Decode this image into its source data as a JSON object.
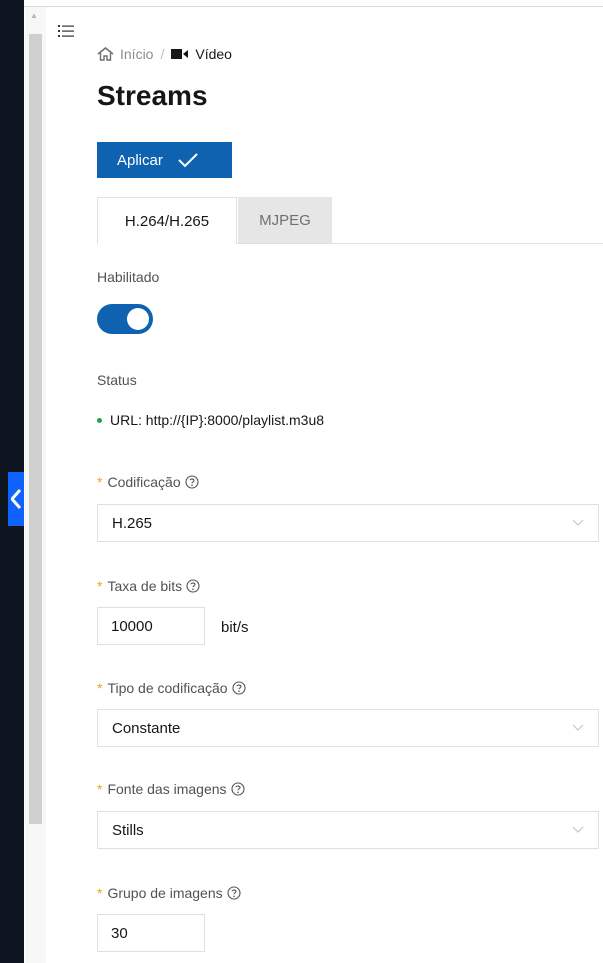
{
  "breadcrumb": {
    "home": "Início",
    "separator": "/",
    "current": "Vídeo"
  },
  "page": {
    "title": "Streams"
  },
  "toolbar": {
    "apply_label": "Aplicar"
  },
  "tabs": [
    {
      "label": "H.264/H.265",
      "active": true
    },
    {
      "label": "MJPEG",
      "active": false
    }
  ],
  "enabled": {
    "label": "Habilitado",
    "value": true
  },
  "status": {
    "label": "Status",
    "url": "URL: http://{IP}:8000/playlist.m3u8"
  },
  "fields": {
    "encoding": {
      "label": "Codificação",
      "value": "H.265"
    },
    "bitrate": {
      "label": "Taxa de bits",
      "value": "10000",
      "unit": "bit/s"
    },
    "encoding_type": {
      "label": "Tipo de codificação",
      "value": "Constante"
    },
    "image_source": {
      "label": "Fonte das imagens",
      "value": "Stills"
    },
    "gop": {
      "label": "Grupo de imagens",
      "value": "30"
    }
  },
  "colors": {
    "primary": "#0f62b0",
    "required": "#f1a11e",
    "status_ok": "#24a148",
    "sidebar": "#0d1620"
  }
}
